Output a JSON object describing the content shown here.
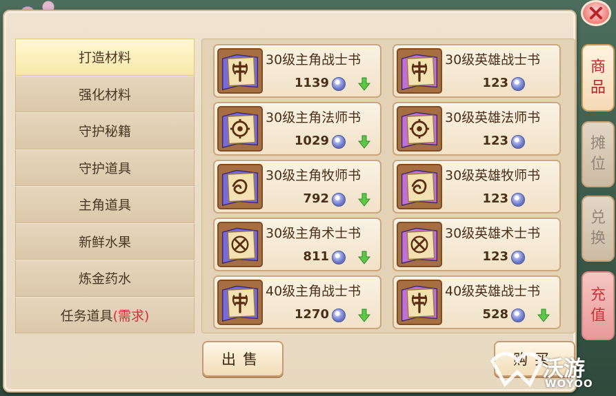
{
  "categories": [
    {
      "label": "打造材料",
      "selected": true
    },
    {
      "label": "强化材料",
      "selected": false
    },
    {
      "label": "守护秘籍",
      "selected": false
    },
    {
      "label": "守护道具",
      "selected": false
    },
    {
      "label": "主角道具",
      "selected": false
    },
    {
      "label": "新鲜水果",
      "selected": false
    },
    {
      "label": "炼金药水",
      "selected": false
    },
    {
      "label": "任务道具",
      "label_suffix": "(需求)",
      "selected": false
    }
  ],
  "items": [
    {
      "name": "30级主角战士书",
      "price": "1139",
      "icon": "warrior-book-icon",
      "book_color": "#7a6ad6",
      "arrow": true
    },
    {
      "name": "30级英雄战士书",
      "price": "123",
      "icon": "warrior-book-icon",
      "book_color": "#c46fd3",
      "arrow": false
    },
    {
      "name": "30级主角法师书",
      "price": "1029",
      "icon": "mage-book-icon",
      "book_color": "#7a6ad6",
      "arrow": true
    },
    {
      "name": "30级英雄法师书",
      "price": "123",
      "icon": "mage-book-icon",
      "book_color": "#c46fd3",
      "arrow": false
    },
    {
      "name": "30级主角牧师书",
      "price": "792",
      "icon": "priest-book-icon",
      "book_color": "#7a6ad6",
      "arrow": true
    },
    {
      "name": "30级英雄牧师书",
      "price": "123",
      "icon": "priest-book-icon",
      "book_color": "#c46fd3",
      "arrow": false
    },
    {
      "name": "30级主角术士书",
      "price": "811",
      "icon": "warlock-book-icon",
      "book_color": "#7a6ad6",
      "arrow": true
    },
    {
      "name": "30级英雄术士书",
      "price": "123",
      "icon": "warlock-book-icon",
      "book_color": "#c46fd3",
      "arrow": false
    },
    {
      "name": "40级主角战士书",
      "price": "1270",
      "icon": "warrior-book-icon",
      "book_color": "#7a6ad6",
      "arrow": true
    },
    {
      "name": "40级英雄战士书",
      "price": "528",
      "icon": "warrior-book-icon",
      "book_color": "#c46fd3",
      "arrow": true
    }
  ],
  "buttons": {
    "sell": "出售",
    "buy": "购买"
  },
  "side_tabs": [
    {
      "label": "商品",
      "state": "active"
    },
    {
      "label": "摊位",
      "state": "inactive"
    },
    {
      "label": "兑换",
      "state": "inactive"
    },
    {
      "label": "充值",
      "state": "recharge"
    }
  ],
  "watermark": {
    "text": "沃游",
    "sub": "WOYOO"
  },
  "colors": {
    "price_down_arrow": "#5bc84a",
    "currency": "#6a74c2",
    "selected_category": "#f7e8a8"
  }
}
